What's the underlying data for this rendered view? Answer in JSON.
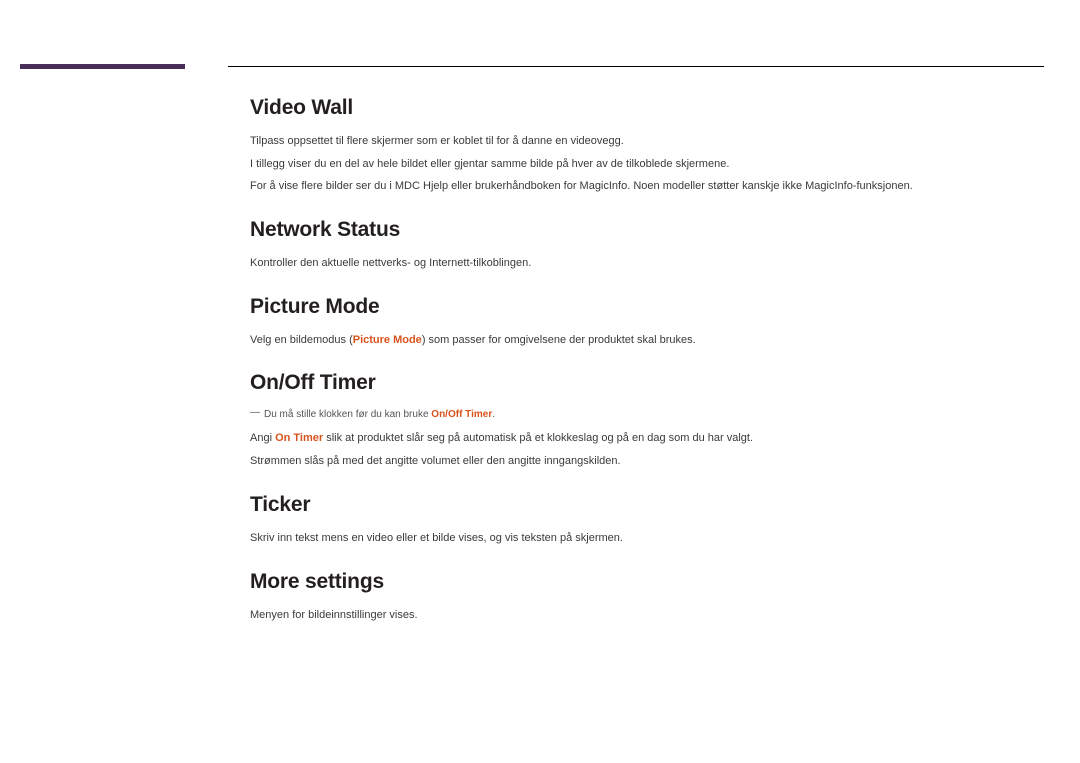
{
  "sections": [
    {
      "heading": "Video Wall",
      "paragraphs": [
        {
          "plain": "Tilpass oppsettet til flere skjermer som er koblet til for å danne en videovegg."
        },
        {
          "plain": "I tillegg viser du en del av hele bildet eller gjentar samme bilde på hver av de tilkoblede skjermene."
        },
        {
          "plain": "For å vise flere bilder ser du i MDC Hjelp eller brukerhåndboken for MagicInfo. Noen modeller støtter kanskje ikke MagicInfo-funksjonen."
        }
      ]
    },
    {
      "heading": "Network Status",
      "paragraphs": [
        {
          "plain": "Kontroller den aktuelle nettverks- og Internett-tilkoblingen."
        }
      ]
    },
    {
      "heading": "Picture Mode",
      "paragraphs": [
        {
          "pre": "Velg en bildemodus (",
          "hl": "Picture Mode",
          "post": ") som passer for omgivelsene der produktet skal brukes."
        }
      ]
    },
    {
      "heading": "On/Off Timer",
      "note": {
        "pre": "Du må stille klokken før du kan bruke ",
        "hl": "On/Off Timer",
        "post": "."
      },
      "paragraphs": [
        {
          "pre": "Angi ",
          "hl": "On Timer",
          "post": " slik at produktet slår seg på automatisk på et klokkeslag og på en dag som du har valgt."
        },
        {
          "plain": "Strømmen slås på med det angitte volumet eller den angitte inngangskilden."
        }
      ]
    },
    {
      "heading": "Ticker",
      "paragraphs": [
        {
          "plain": "Skriv inn tekst mens en video eller et bilde vises, og vis teksten på skjermen."
        }
      ]
    },
    {
      "heading": "More settings",
      "paragraphs": [
        {
          "plain": "Menyen for bildeinnstillinger vises."
        }
      ]
    }
  ]
}
